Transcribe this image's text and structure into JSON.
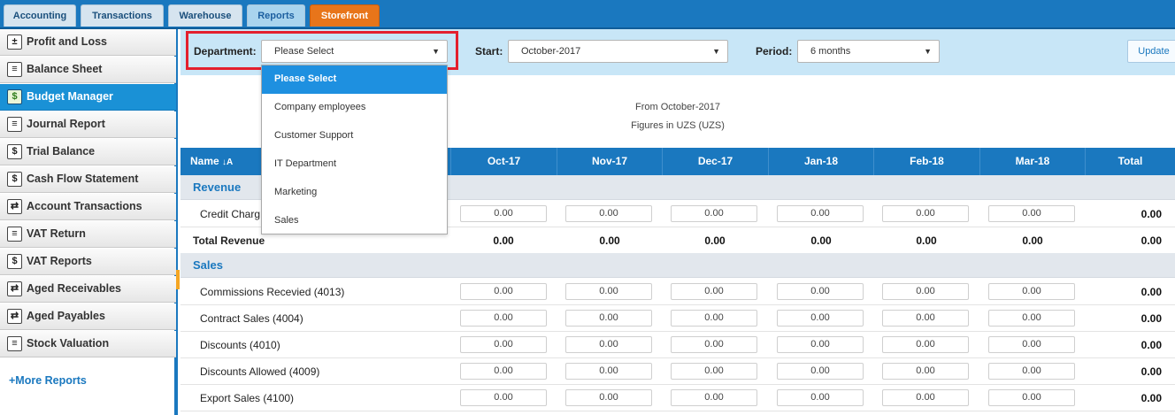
{
  "tabs": [
    {
      "label": "Accounting"
    },
    {
      "label": "Transactions"
    },
    {
      "label": "Warehouse"
    },
    {
      "label": "Reports"
    },
    {
      "label": "Storefront"
    }
  ],
  "sidebar": {
    "items": [
      {
        "label": "Profit and Loss",
        "icon": "profit-loss-icon",
        "glyph": "±"
      },
      {
        "label": "Balance Sheet",
        "icon": "balance-sheet-icon",
        "glyph": "≡"
      },
      {
        "label": "Budget Manager",
        "icon": "budget-manager-icon",
        "glyph": "$"
      },
      {
        "label": "Journal Report",
        "icon": "journal-report-icon",
        "glyph": "≡"
      },
      {
        "label": "Trial Balance",
        "icon": "trial-balance-icon",
        "glyph": "$"
      },
      {
        "label": "Cash Flow Statement",
        "icon": "cash-flow-icon",
        "glyph": "$"
      },
      {
        "label": "Account Transactions",
        "icon": "account-transactions-icon",
        "glyph": "⇄"
      },
      {
        "label": "VAT Return",
        "icon": "vat-return-icon",
        "glyph": "≡"
      },
      {
        "label": "VAT Reports",
        "icon": "vat-reports-icon",
        "glyph": "$"
      },
      {
        "label": "Aged Receivables",
        "icon": "aged-receivables-icon",
        "glyph": "⇄"
      },
      {
        "label": "Aged Payables",
        "icon": "aged-payables-icon",
        "glyph": "⇄"
      },
      {
        "label": "Stock Valuation",
        "icon": "stock-valuation-icon",
        "glyph": "≡"
      }
    ],
    "more_reports": "+More Reports"
  },
  "filters": {
    "department_label": "Department:",
    "department_value": "Please Select",
    "start_label": "Start:",
    "start_value": "October-2017",
    "period_label": "Period:",
    "period_value": "6 months",
    "update_label": "Update"
  },
  "dropdown": {
    "options": [
      "Please Select",
      "Company employees",
      "Customer Support",
      "IT Department",
      "Marketing",
      "Sales"
    ]
  },
  "report": {
    "from_text": "From October-2017",
    "figures_text": "Figures in UZS (UZS)"
  },
  "table": {
    "name_header": "Name",
    "sort_icon": "sort-alpha-icon",
    "months": [
      "Oct-17",
      "Nov-17",
      "Dec-17",
      "Jan-18",
      "Feb-18",
      "Mar-18"
    ],
    "total_header": "Total",
    "revenue_section": "Revenue",
    "revenue_rows": [
      {
        "name": "Credit Charg",
        "values": [
          "0.00",
          "0.00",
          "0.00",
          "0.00",
          "0.00",
          "0.00"
        ],
        "total": "0.00"
      }
    ],
    "total_revenue": {
      "name": "Total Revenue",
      "values": [
        "0.00",
        "0.00",
        "0.00",
        "0.00",
        "0.00",
        "0.00"
      ],
      "total": "0.00"
    },
    "sales_section": "Sales",
    "sales_rows": [
      {
        "name": "Commissions Recevied (4013)",
        "values": [
          "0.00",
          "0.00",
          "0.00",
          "0.00",
          "0.00",
          "0.00"
        ],
        "total": "0.00"
      },
      {
        "name": "Contract Sales (4004)",
        "values": [
          "0.00",
          "0.00",
          "0.00",
          "0.00",
          "0.00",
          "0.00"
        ],
        "total": "0.00"
      },
      {
        "name": "Discounts (4010)",
        "values": [
          "0.00",
          "0.00",
          "0.00",
          "0.00",
          "0.00",
          "0.00"
        ],
        "total": "0.00"
      },
      {
        "name": "Discounts Allowed (4009)",
        "values": [
          "0.00",
          "0.00",
          "0.00",
          "0.00",
          "0.00",
          "0.00"
        ],
        "total": "0.00"
      },
      {
        "name": "Export Sales (4100)",
        "values": [
          "0.00",
          "0.00",
          "0.00",
          "0.00",
          "0.00",
          "0.00"
        ],
        "total": "0.00"
      }
    ]
  },
  "colors": {
    "brand_blue": "#1a78bf",
    "storefront_orange": "#e8751a",
    "highlight_red": "#e3202e"
  }
}
